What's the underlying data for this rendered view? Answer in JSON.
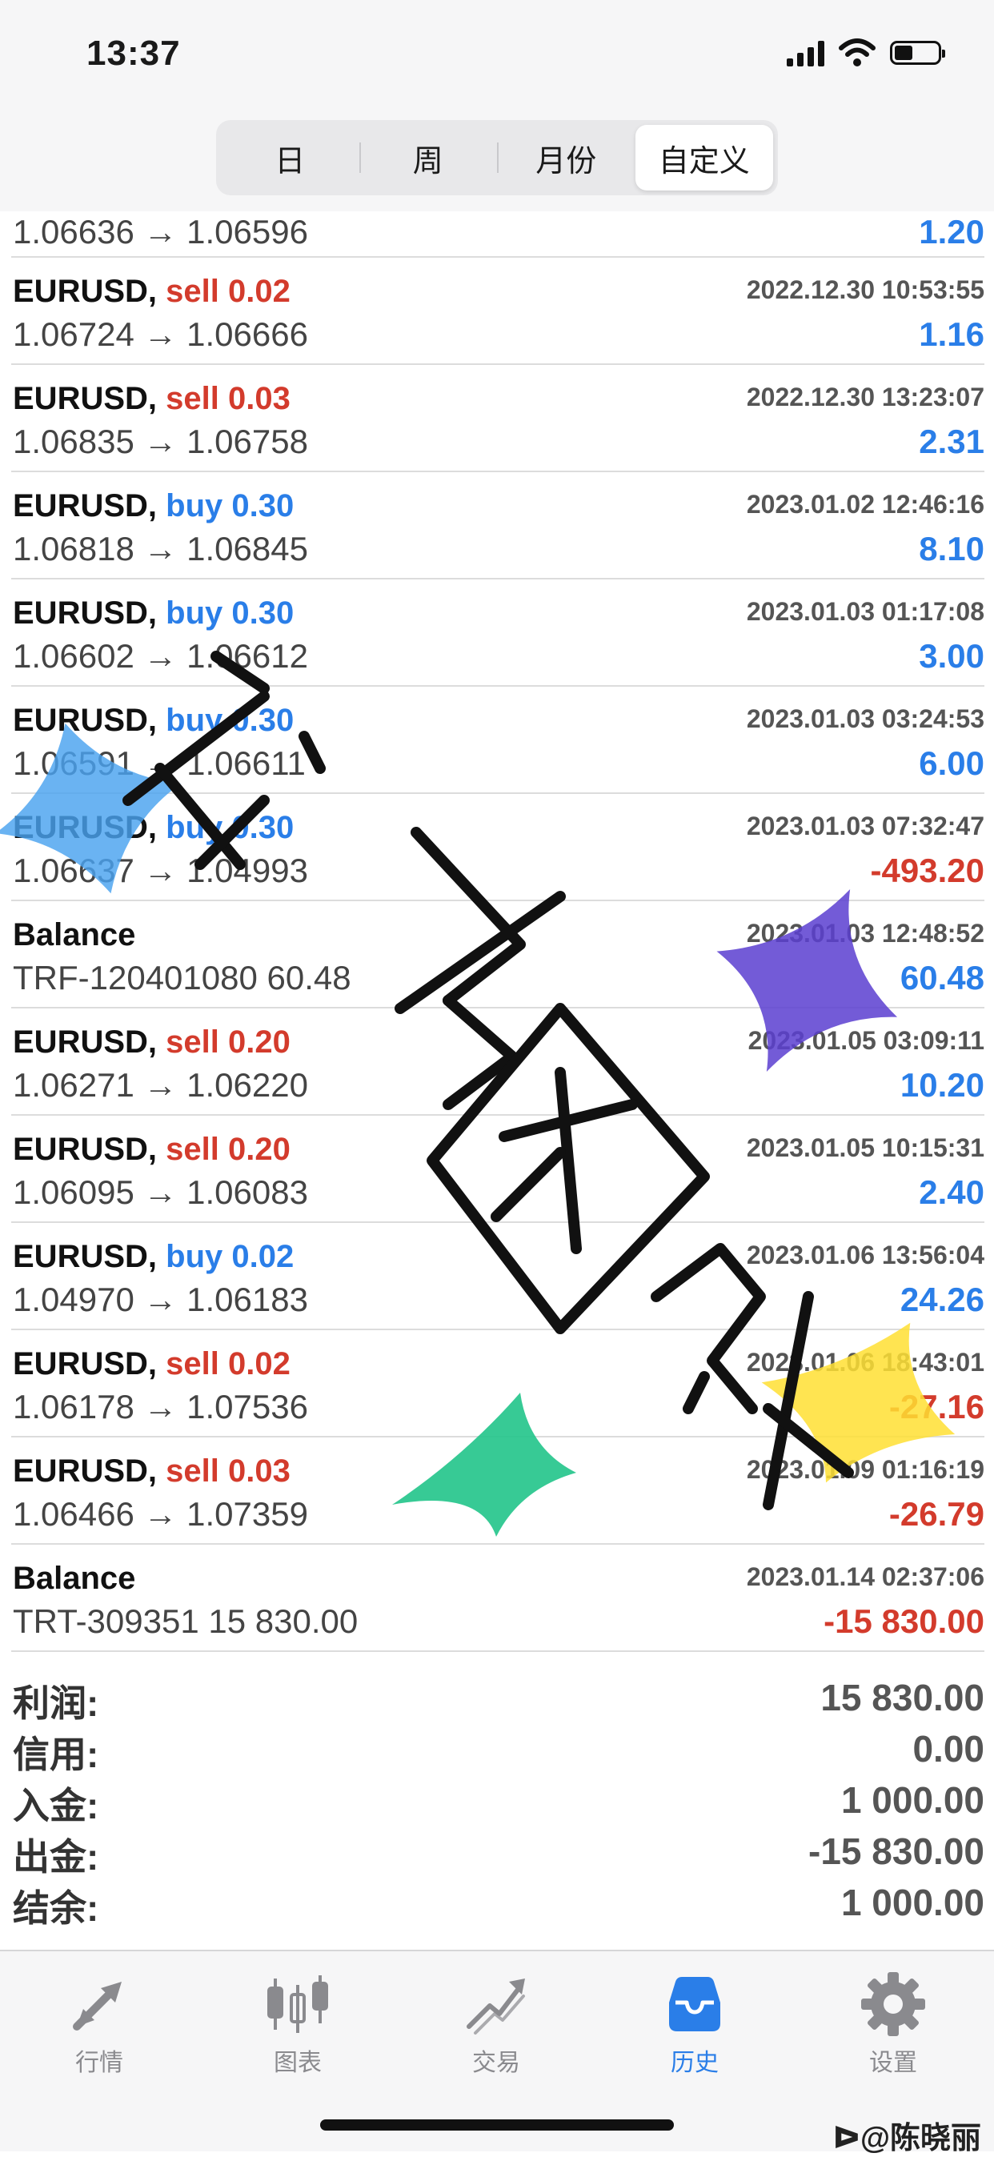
{
  "status_bar": {
    "time": "13:37"
  },
  "segments": [
    {
      "label": "日",
      "active": false
    },
    {
      "label": "周",
      "active": false
    },
    {
      "label": "月份",
      "active": false
    },
    {
      "label": "自定义",
      "active": true
    }
  ],
  "first_row": {
    "prices": "1.06636 → 1.06596",
    "profit": "1.20"
  },
  "trades": [
    {
      "symbol": "EURUSD,",
      "side": "sell 0.02",
      "type": "sell",
      "time": "2022.12.30 10:53:55",
      "prices": "1.06724 → 1.06666",
      "profit": "1.16",
      "sign": "pos"
    },
    {
      "symbol": "EURUSD,",
      "side": "sell 0.03",
      "type": "sell",
      "time": "2022.12.30 13:23:07",
      "prices": "1.06835 → 1.06758",
      "profit": "2.31",
      "sign": "pos"
    },
    {
      "symbol": "EURUSD,",
      "side": "buy 0.30",
      "type": "buy",
      "time": "2023.01.02 12:46:16",
      "prices": "1.06818 → 1.06845",
      "profit": "8.10",
      "sign": "pos"
    },
    {
      "symbol": "EURUSD,",
      "side": "buy 0.30",
      "type": "buy",
      "time": "2023.01.03 01:17:08",
      "prices": "1.06602 → 1.06612",
      "profit": "3.00",
      "sign": "pos"
    },
    {
      "symbol": "EURUSD,",
      "side": "buy 0.30",
      "type": "buy",
      "time": "2023.01.03 03:24:53",
      "prices": "1.06591 → 1.06611",
      "profit": "6.00",
      "sign": "pos"
    },
    {
      "symbol": "EURUSD,",
      "side": "buy 0.30",
      "type": "buy",
      "time": "2023.01.03 07:32:47",
      "prices": "1.06637 → 1.04993",
      "profit": "-493.20",
      "sign": "neg"
    },
    {
      "symbol": "Balance",
      "side": "",
      "type": "balance",
      "time": "2023.01.03 12:48:52",
      "prices": "TRF-120401080 60.48",
      "profit": "60.48",
      "sign": "pos"
    },
    {
      "symbol": "EURUSD,",
      "side": "sell 0.20",
      "type": "sell",
      "time": "2023.01.05 03:09:11",
      "prices": "1.06271 → 1.06220",
      "profit": "10.20",
      "sign": "pos"
    },
    {
      "symbol": "EURUSD,",
      "side": "sell 0.20",
      "type": "sell",
      "time": "2023.01.05 10:15:31",
      "prices": "1.06095 → 1.06083",
      "profit": "2.40",
      "sign": "pos"
    },
    {
      "symbol": "EURUSD,",
      "side": "buy 0.02",
      "type": "buy",
      "time": "2023.01.06 13:56:04",
      "prices": "1.04970 → 1.06183",
      "profit": "24.26",
      "sign": "pos"
    },
    {
      "symbol": "EURUSD,",
      "side": "sell 0.02",
      "type": "sell",
      "time": "2023.01.06 18:43:01",
      "prices": "1.06178 → 1.07536",
      "profit": "-27.16",
      "sign": "neg"
    },
    {
      "symbol": "EURUSD,",
      "side": "sell 0.03",
      "type": "sell",
      "time": "2023.01.09 01:16:19",
      "prices": "1.06466 → 1.07359",
      "profit": "-26.79",
      "sign": "neg"
    },
    {
      "symbol": "Balance",
      "side": "",
      "type": "balance",
      "time": "2023.01.14 02:37:06",
      "prices": "TRT-309351 15 830.00",
      "profit": "-15 830.00",
      "sign": "neg"
    }
  ],
  "summary": [
    {
      "label": "利润:",
      "value": "15 830.00"
    },
    {
      "label": "信用:",
      "value": "0.00"
    },
    {
      "label": "入金:",
      "value": "1 000.00"
    },
    {
      "label": "出金:",
      "value": "-15 830.00"
    },
    {
      "label": "结余:",
      "value": "1 000.00"
    }
  ],
  "tabs": [
    {
      "label": "行情",
      "icon": "quotes-arrows-icon",
      "active": false
    },
    {
      "label": "图表",
      "icon": "candlestick-chart-icon",
      "active": false
    },
    {
      "label": "交易",
      "icon": "trade-trend-icon",
      "active": false
    },
    {
      "label": "历史",
      "icon": "history-inbox-icon",
      "active": true
    },
    {
      "label": "设置",
      "icon": "gear-icon",
      "active": false
    }
  ],
  "watermark": {
    "text": "豆子团队",
    "credit": "ᐅ@陈晓丽"
  },
  "colors": {
    "accent_blue": "#2a7ee8",
    "loss_red": "#d33b2c",
    "header_bg": "#f6f6f7"
  }
}
